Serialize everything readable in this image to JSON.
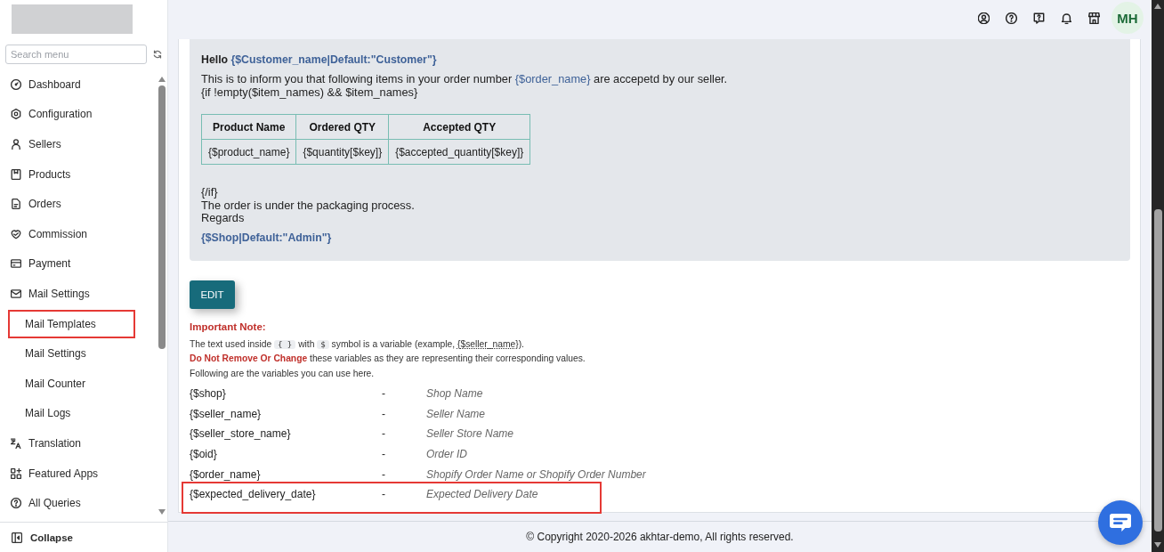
{
  "sidebar": {
    "search": {
      "placeholder": "Search menu"
    },
    "menu": [
      {
        "label": "Dashboard",
        "highlighted": false
      },
      {
        "label": "Configuration",
        "highlighted": false
      },
      {
        "label": "Sellers",
        "highlighted": false
      },
      {
        "label": "Products",
        "highlighted": false
      },
      {
        "label": "Orders",
        "highlighted": false
      },
      {
        "label": "Commission",
        "highlighted": false
      },
      {
        "label": "Payment",
        "highlighted": false
      },
      {
        "label": "Mail Settings",
        "highlighted": false,
        "children": [
          {
            "label": "Mail Templates",
            "highlighted": true
          },
          {
            "label": "Mail Settings",
            "highlighted": false
          },
          {
            "label": "Mail Counter",
            "highlighted": false
          },
          {
            "label": "Mail Logs",
            "highlighted": false
          }
        ]
      },
      {
        "label": "Translation",
        "highlighted": false
      },
      {
        "label": "Featured Apps",
        "highlighted": false
      },
      {
        "label": "All Queries",
        "highlighted": false
      }
    ],
    "collapse": {
      "label": "Collapse"
    }
  },
  "header": {
    "avatar": "MH"
  },
  "template": {
    "greeting": [
      {
        "kind": "text",
        "text": "Hello "
      },
      {
        "kind": "variable",
        "text": "{$Customer_name|Default:\"Customer\"}"
      }
    ],
    "intro": [
      {
        "kind": "text",
        "text": "This is to inform you that following items in your order number "
      },
      {
        "kind": "variable",
        "text": "{$order_name}"
      },
      {
        "kind": "text",
        "text": " are accepetd by our seller."
      }
    ],
    "condition_open": "{if !empty($item_names) && $item_names}",
    "table": {
      "columns": [
        "Product Name",
        "Ordered QTY",
        "Accepted QTY"
      ],
      "rows": [
        [
          "{$product_name}",
          "{$quantity[$key]}",
          "{$accepted_quantity[$key]}"
        ]
      ]
    },
    "condition_close": "{/if}",
    "body": "The order is under the packaging process.",
    "closing": "Regards",
    "signature": "{$Shop|Default:\"Admin\"}"
  },
  "edit_button": "EDIT",
  "note": {
    "title": "Important Note:",
    "lines": [
      [
        {
          "kind": "text",
          "text": "The text used inside "
        },
        {
          "kind": "code",
          "text": "{ }"
        },
        {
          "kind": "text",
          "text": " with "
        },
        {
          "kind": "code",
          "text": "$"
        },
        {
          "kind": "text",
          "text": " symbol is a variable (example, "
        },
        {
          "kind": "abbr",
          "text": "{$seller_name}"
        },
        {
          "kind": "text",
          "text": ")."
        }
      ],
      [
        {
          "kind": "strong",
          "text": "Do Not Remove Or Change"
        },
        {
          "kind": "text",
          "text": " these variables as they are representing their corresponding values."
        }
      ],
      [
        {
          "kind": "text",
          "text": "Following are the variables you can use here."
        }
      ]
    ]
  },
  "variables": [
    {
      "name": "{$shop}",
      "separator": "-",
      "description": "Shop Name",
      "highlighted": false
    },
    {
      "name": "{$seller_name}",
      "separator": "-",
      "description": "Seller Name",
      "highlighted": false
    },
    {
      "name": "{$seller_store_name}",
      "separator": "-",
      "description": "Seller Store Name",
      "highlighted": false
    },
    {
      "name": "{$oid}",
      "separator": "-",
      "description": "Order ID",
      "highlighted": false
    },
    {
      "name": "{$order_name}",
      "separator": "-",
      "description": "Shopify Order Name or Shopify Order Number",
      "highlighted": false
    },
    {
      "name": "{$expected_delivery_date}",
      "separator": "-",
      "description": "Expected Delivery Date",
      "highlighted": true
    }
  ],
  "footer": "© Copyright 2020-2026 akhtar-demo, All rights reserved."
}
